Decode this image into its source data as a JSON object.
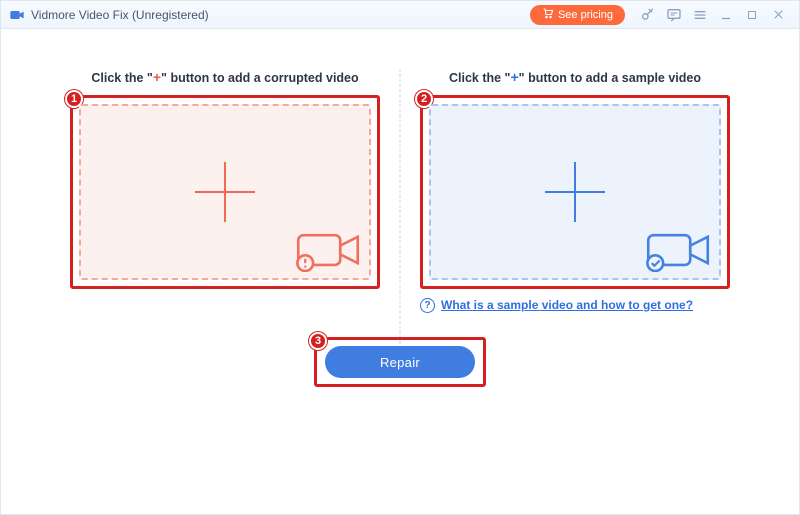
{
  "titlebar": {
    "title": "Vidmore Video Fix (Unregistered)",
    "pricing_label": "See pricing"
  },
  "left": {
    "instruction_prefix": "Click the \"",
    "instruction_plus": "+",
    "instruction_suffix": "\" button to add a corrupted video",
    "badge": "1"
  },
  "right": {
    "instruction_prefix": "Click the \"",
    "instruction_plus": "+",
    "instruction_suffix": "\" button to add a sample video",
    "badge": "2",
    "help_link": "What is a sample video and how to get one?",
    "help_icon": "?"
  },
  "footer": {
    "badge": "3",
    "repair_label": "Repair"
  }
}
